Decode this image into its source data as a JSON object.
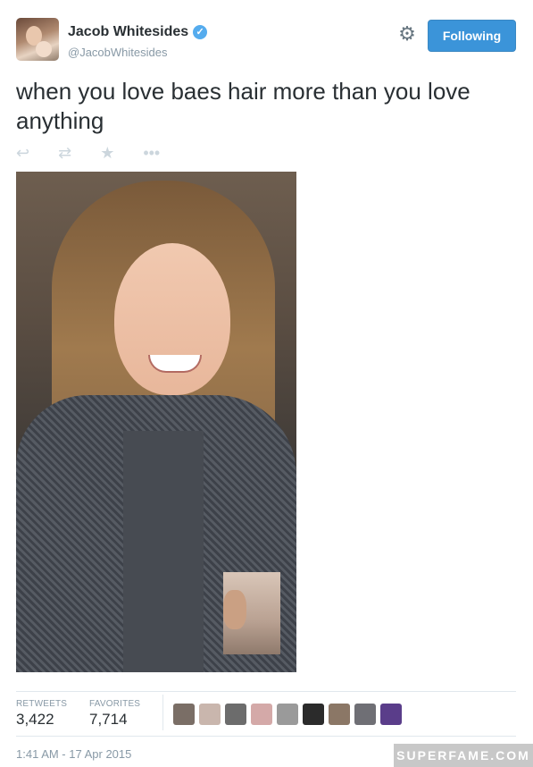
{
  "profile": {
    "name": "Jacob Whitesides",
    "handle": "@JacobWhitesides",
    "verified": true
  },
  "header": {
    "follow_label": "Following",
    "gear_icon": "gear-icon"
  },
  "tweet": {
    "text": "when you love baes hair more than you love anything"
  },
  "actions": {
    "reply_icon": "reply-icon",
    "retweet_icon": "retweet-icon",
    "favorite_icon": "star-icon",
    "more_icon": "more-icon"
  },
  "stats": {
    "retweets_label": "RETWEETS",
    "retweets_value": "3,422",
    "favorites_label": "FAVORITES",
    "favorites_value": "7,714"
  },
  "favoriters": [
    {
      "color": "#7a6e66"
    },
    {
      "color": "#c9b6ad"
    },
    {
      "color": "#6c6c6c"
    },
    {
      "color": "#d4a9a8"
    },
    {
      "color": "#9a9a9a"
    },
    {
      "color": "#2b2b2b"
    },
    {
      "color": "#8b7766"
    },
    {
      "color": "#6f6f75"
    },
    {
      "color": "#5a3d8a"
    }
  ],
  "timestamp": "1:41 AM - 17 Apr 2015",
  "watermark": "SUPERFAME.COM",
  "colors": {
    "accent": "#3b94d9",
    "muted_text": "#8899a6",
    "icon_gray": "#ccd6dd"
  }
}
